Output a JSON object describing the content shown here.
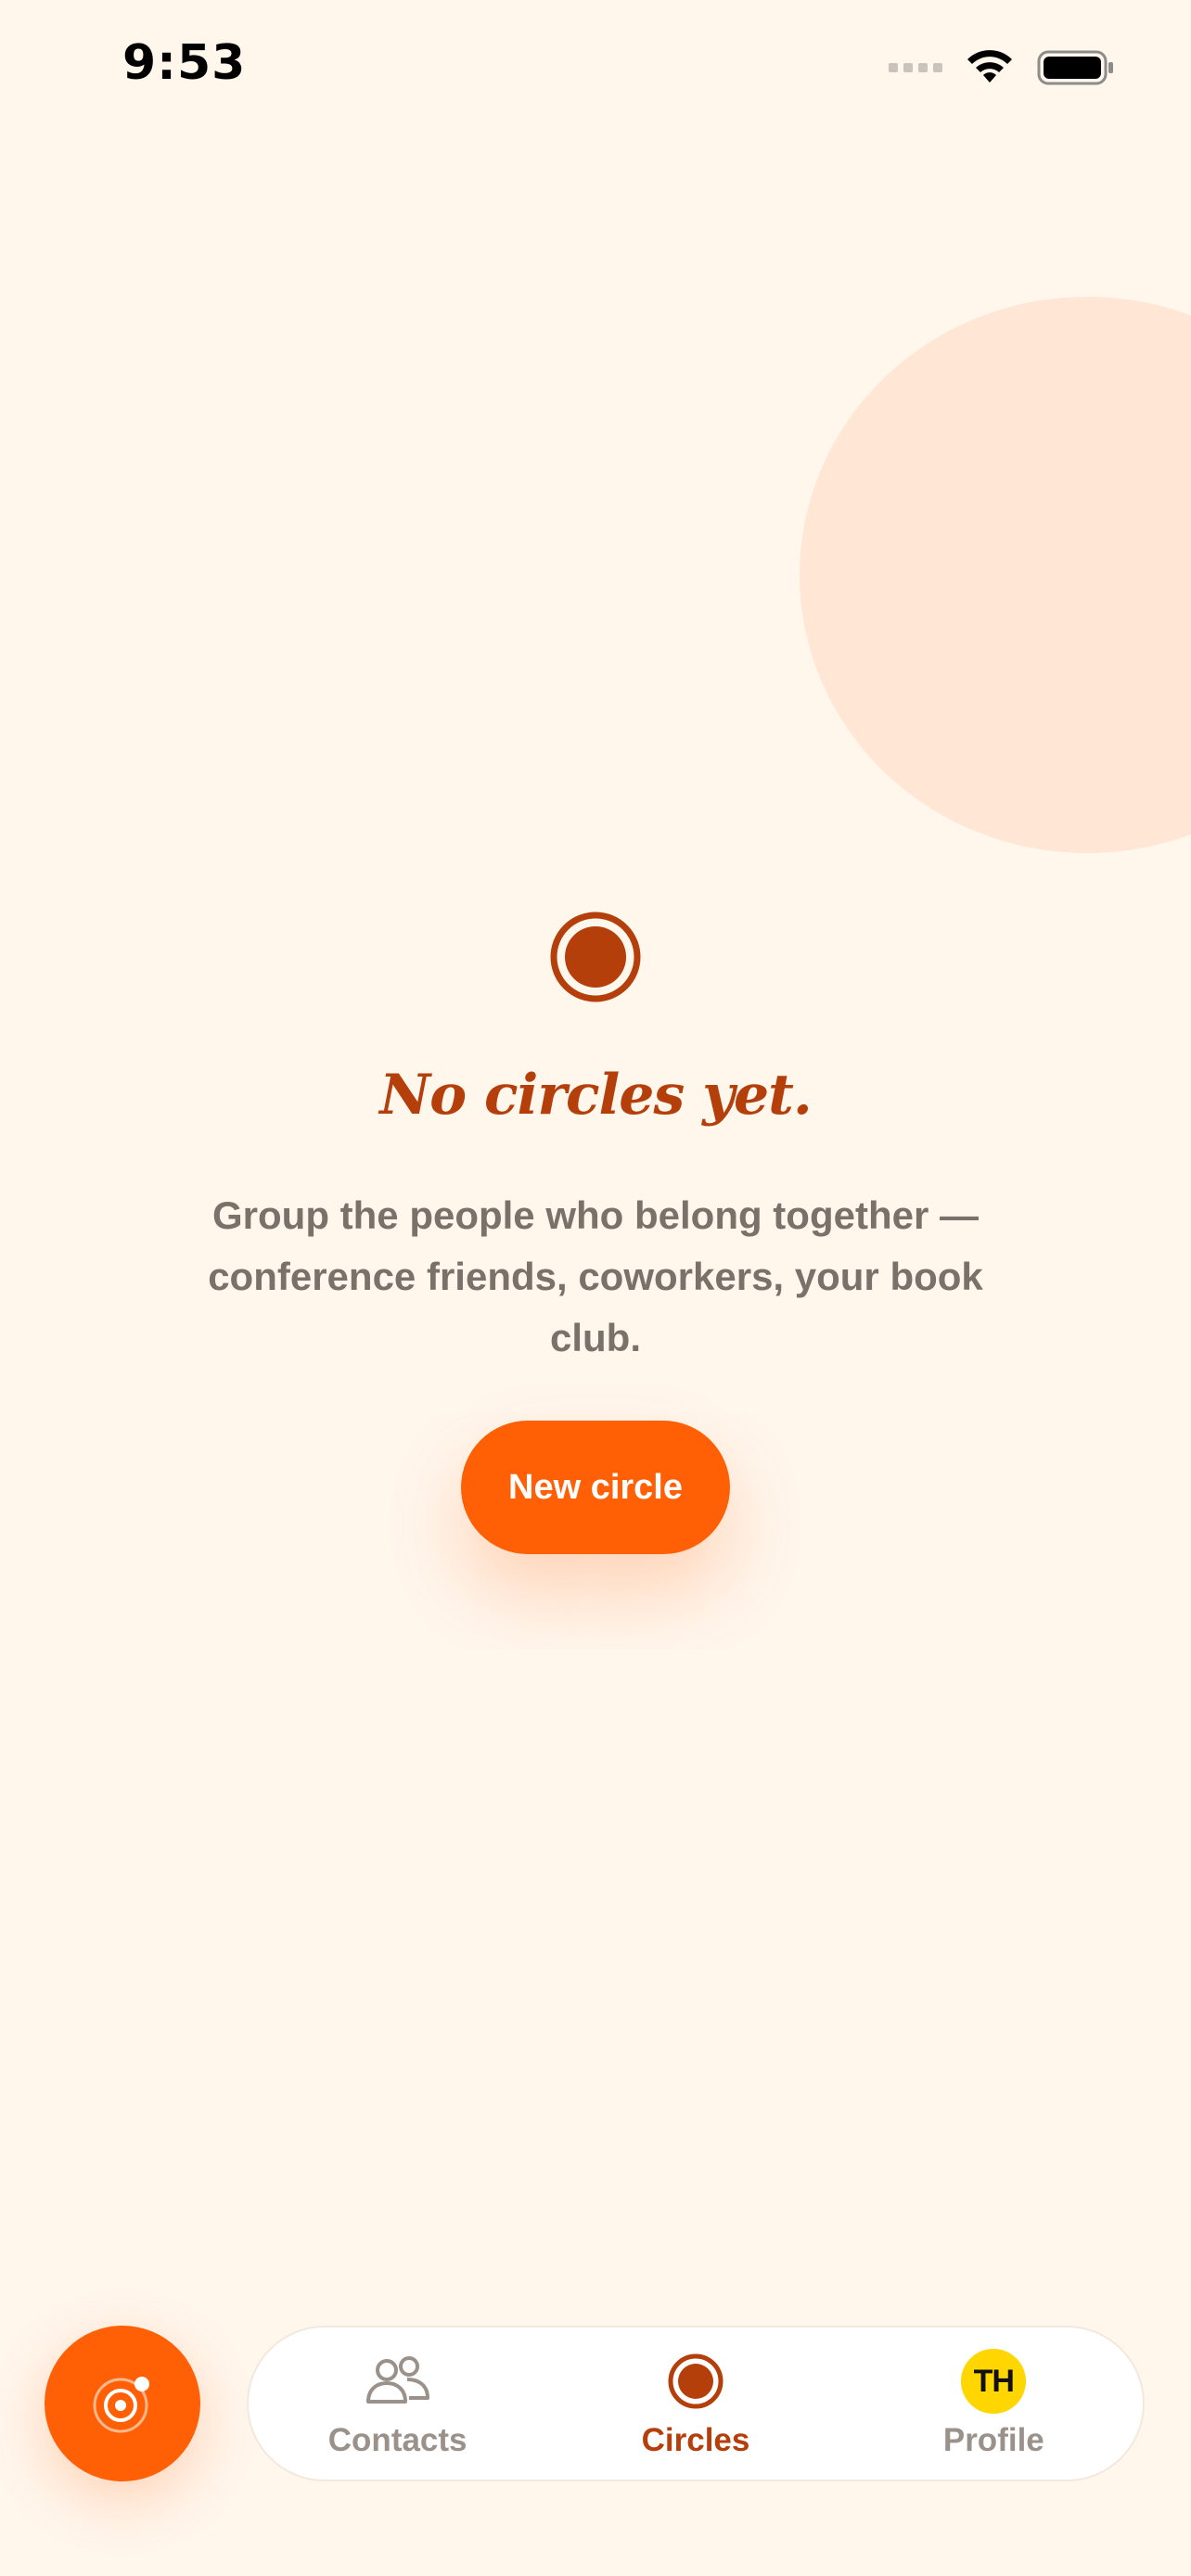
{
  "status_bar": {
    "time": "9:53",
    "icons": [
      "signal-dots-icon",
      "wifi-icon",
      "battery-icon"
    ]
  },
  "empty_state": {
    "icon": "circle-target-icon",
    "title": "No circles yet.",
    "description": "Group the people who belong together — conference friends, coworkers, your book club.",
    "button_label": "New circle"
  },
  "fab": {
    "icon": "radar-icon"
  },
  "tab_bar": {
    "tabs": [
      {
        "label": "Contacts",
        "icon": "people-icon",
        "active": false
      },
      {
        "label": "Circles",
        "icon": "circle-icon",
        "active": true
      },
      {
        "label": "Profile",
        "icon": "avatar",
        "active": false,
        "avatar_initials": "TH"
      }
    ]
  },
  "colors": {
    "background": "#FFF6EC",
    "accent": "#FF5F05",
    "accent_dark": "#B53F0B",
    "muted_text": "#7A716A",
    "tab_inactive": "#9A918A",
    "avatar_bg": "#FFD600",
    "blob": "#FFE6D5"
  }
}
